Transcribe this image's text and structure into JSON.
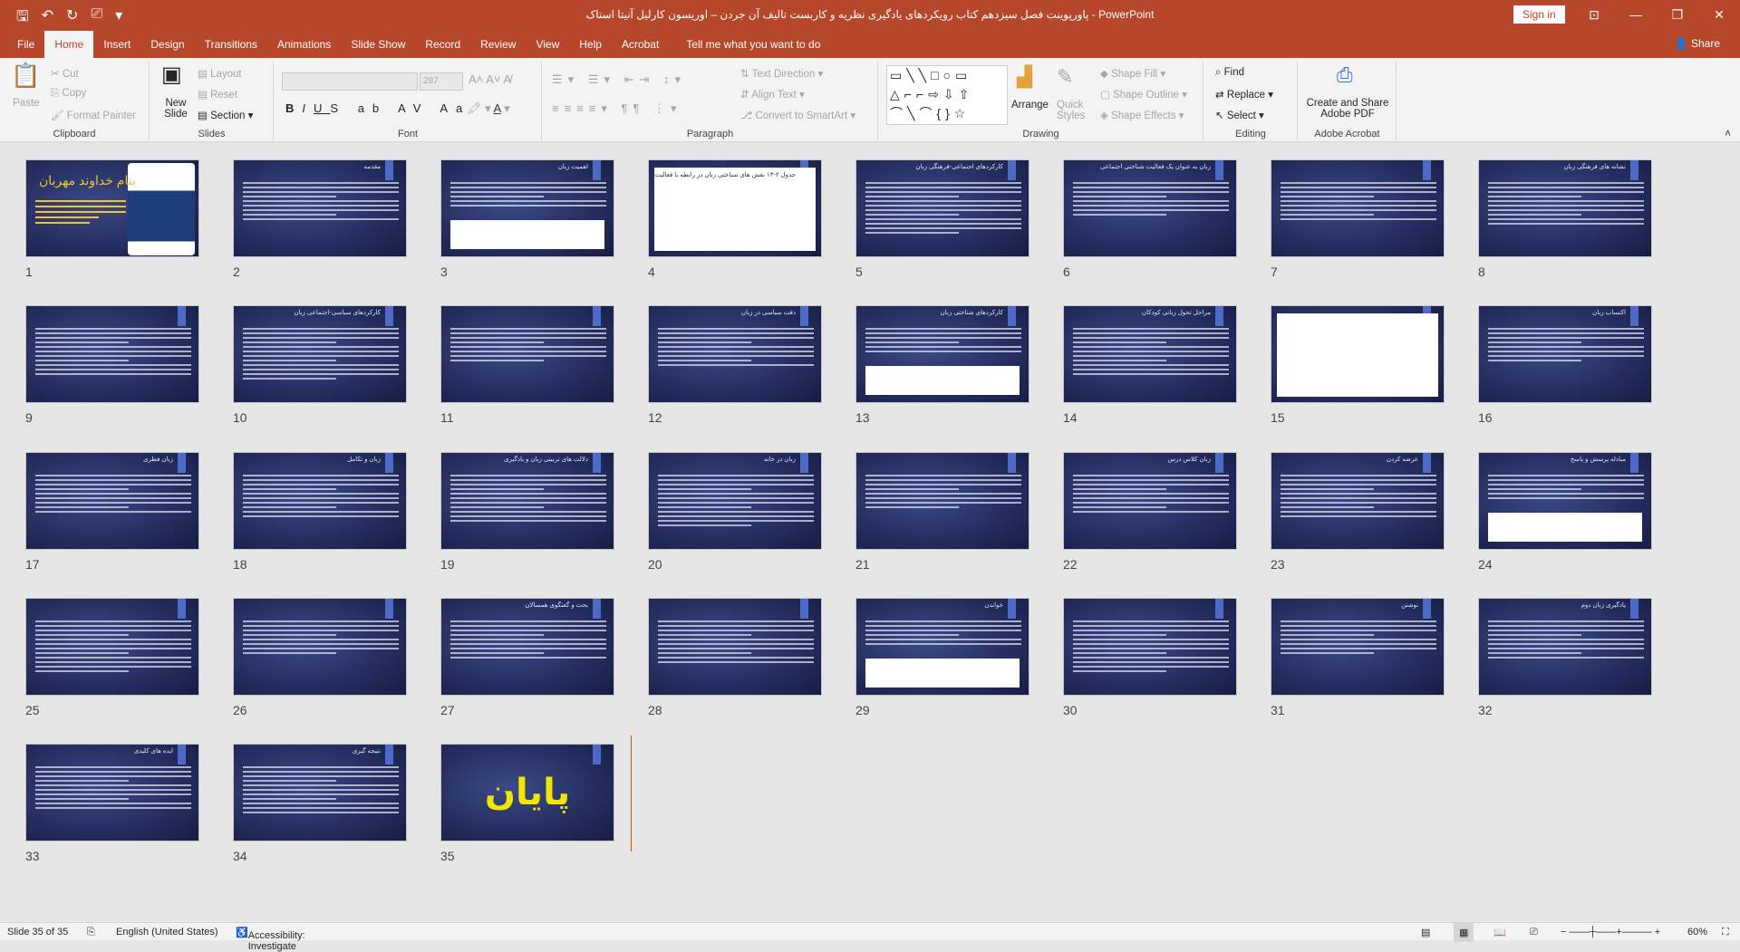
{
  "window": {
    "title": "پاورپوینت فصل سیزدهم کتاب رویکردهای یادگیری نظریه و کاربست تالیف آن جردن – اوریسون کارلیل آنیتا استاک  -  PowerPoint",
    "sign_in": "Sign in"
  },
  "tabs": [
    {
      "label": "File"
    },
    {
      "label": "Home"
    },
    {
      "label": "Insert"
    },
    {
      "label": "Design"
    },
    {
      "label": "Transitions"
    },
    {
      "label": "Animations"
    },
    {
      "label": "Slide Show"
    },
    {
      "label": "Record"
    },
    {
      "label": "Review"
    },
    {
      "label": "View"
    },
    {
      "label": "Help"
    },
    {
      "label": "Acrobat"
    },
    {
      "label": "Tell me what you want to do"
    }
  ],
  "share": "Share",
  "ribbon": {
    "clipboard": {
      "label": "Clipboard",
      "paste": "Paste",
      "cut": "Cut",
      "copy": "Copy",
      "format_painter": "Format Painter"
    },
    "slides": {
      "label": "Slides",
      "new_slide": "New Slide",
      "layout": "Layout",
      "reset": "Reset",
      "section": "Section"
    },
    "font": {
      "label": "Font",
      "size": "287"
    },
    "paragraph": {
      "label": "Paragraph",
      "text_direction": "Text Direction",
      "align_text": "Align Text",
      "convert": "Convert to SmartArt"
    },
    "drawing": {
      "label": "Drawing",
      "arrange": "Arrange",
      "quick_styles": "Quick Styles",
      "shape_fill": "Shape Fill",
      "shape_outline": "Shape Outline",
      "shape_effects": "Shape Effects"
    },
    "editing": {
      "label": "Editing",
      "find": "Find",
      "replace": "Replace",
      "select": "Select"
    },
    "acrobat": {
      "label": "Adobe Acrobat",
      "create": "Create and Share Adobe PDF"
    }
  },
  "slides": [
    {
      "n": "1",
      "kind": "title",
      "title": "بنام خداوند مهربان"
    },
    {
      "n": "2",
      "kind": "text",
      "title": "مقدمه"
    },
    {
      "n": "3",
      "kind": "texttable",
      "title": "اهمیت زبان"
    },
    {
      "n": "4",
      "kind": "white",
      "title": "جدول ۲-۱۳ نقش های شناختی زبان در رابطه با فعالیت‌ها"
    },
    {
      "n": "5",
      "kind": "text",
      "title": "کارکردهای اجتماعی-فرهنگی زبان"
    },
    {
      "n": "6",
      "kind": "text",
      "title": "زبان به عنوان یک فعالیت شناختی اجتماعی"
    },
    {
      "n": "7",
      "kind": "text",
      "title": ""
    },
    {
      "n": "8",
      "kind": "text",
      "title": "نشانه های فرهنگی زبان"
    },
    {
      "n": "9",
      "kind": "text",
      "title": ""
    },
    {
      "n": "10",
      "kind": "text",
      "title": "کارکردهای سیاسی-اجتماعی زبان"
    },
    {
      "n": "11",
      "kind": "text",
      "title": ""
    },
    {
      "n": "12",
      "kind": "text",
      "title": "دقت سیاسی در زبان"
    },
    {
      "n": "13",
      "kind": "texttable",
      "title": "کارکردهای شناختی زبان"
    },
    {
      "n": "14",
      "kind": "text",
      "title": "مراحل تحول زبانی کودکان"
    },
    {
      "n": "15",
      "kind": "white",
      "title": ""
    },
    {
      "n": "16",
      "kind": "text",
      "title": "اکتساب زبان"
    },
    {
      "n": "17",
      "kind": "text",
      "title": "زبان فطری"
    },
    {
      "n": "18",
      "kind": "text",
      "title": "زبان و تکامل"
    },
    {
      "n": "19",
      "kind": "text",
      "title": "دلالت های تربیتی زبان و یادگیری"
    },
    {
      "n": "20",
      "kind": "text",
      "title": "زبان در خانه"
    },
    {
      "n": "21",
      "kind": "text",
      "title": ""
    },
    {
      "n": "22",
      "kind": "text",
      "title": "زبان کلاس درس"
    },
    {
      "n": "23",
      "kind": "text",
      "title": "عرضه کردن"
    },
    {
      "n": "24",
      "kind": "texttable",
      "title": "مبادله پرسش و پاسخ"
    },
    {
      "n": "25",
      "kind": "text",
      "title": ""
    },
    {
      "n": "26",
      "kind": "text",
      "title": ""
    },
    {
      "n": "27",
      "kind": "text",
      "title": "بحث و گفتگوی همسالان"
    },
    {
      "n": "28",
      "kind": "text",
      "title": ""
    },
    {
      "n": "29",
      "kind": "texttable",
      "title": "خواندن"
    },
    {
      "n": "30",
      "kind": "text",
      "title": ""
    },
    {
      "n": "31",
      "kind": "text",
      "title": "نوشتن"
    },
    {
      "n": "32",
      "kind": "text",
      "title": "یادگیری زبان دوم"
    },
    {
      "n": "33",
      "kind": "text",
      "title": "ایده های کلیدی"
    },
    {
      "n": "34",
      "kind": "text",
      "title": "نتیجه گیری"
    },
    {
      "n": "35",
      "kind": "end",
      "title": "پایان"
    }
  ],
  "status": {
    "slide": "Slide 35 of 35",
    "language": "English (United States)",
    "accessibility": "Accessibility: Investigate",
    "zoom": "60%"
  }
}
